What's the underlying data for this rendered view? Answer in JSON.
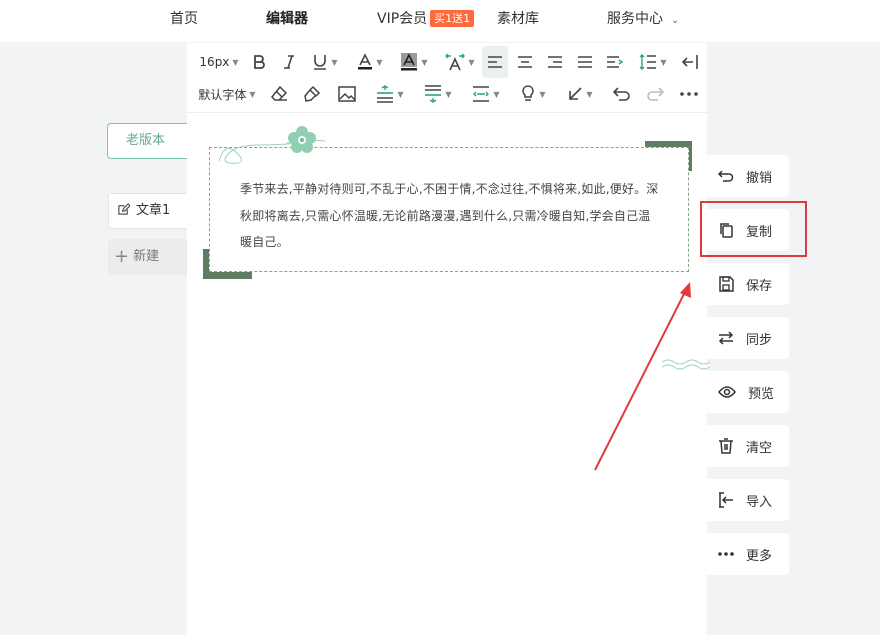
{
  "nav": {
    "items": [
      "首页",
      "编辑器",
      "VIP会员",
      "素材库",
      "服务中心"
    ],
    "vip_badge": "买1送1",
    "accent": "#ff6a3d"
  },
  "sidebar": {
    "old_version": "老版本",
    "doc_name": "文章1",
    "new_label": "新建"
  },
  "toolbar": {
    "font_size": "16px",
    "font_family": "默认字体"
  },
  "template": {
    "text": "季节来去,平静对待则可,不乱于心,不困于情,不念过往,不惧将来,如此,便好。深秋即将离去,只需心怀温暖,无论前路漫漫,遇到什么,只需冷暖自知,学会自己温暖自己。",
    "theme_color": "#5f7d62"
  },
  "actions": [
    "撤销",
    "复制",
    "保存",
    "同步",
    "预览",
    "清空",
    "导入",
    "更多"
  ],
  "annotation": {
    "color": "#e03a3a"
  }
}
